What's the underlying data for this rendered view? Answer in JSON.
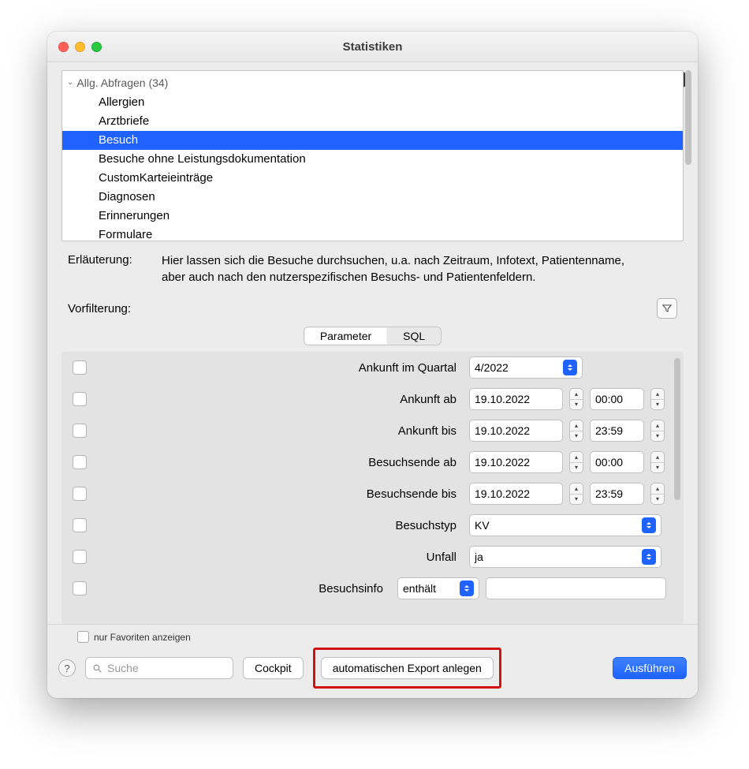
{
  "window": {
    "title": "Statistiken"
  },
  "tree": {
    "group_label": "Allg. Abfragen (34)",
    "items": [
      {
        "label": "Allergien",
        "selected": false
      },
      {
        "label": "Arztbriefe",
        "selected": false
      },
      {
        "label": "Besuch",
        "selected": true
      },
      {
        "label": "Besuche ohne Leistungsdokumentation",
        "selected": false
      },
      {
        "label": "CustomKarteieinträge",
        "selected": false
      },
      {
        "label": "Diagnosen",
        "selected": false
      },
      {
        "label": "Erinnerungen",
        "selected": false
      },
      {
        "label": "Formulare",
        "selected": false
      }
    ]
  },
  "explanation": {
    "label": "Erläuterung:",
    "text": "Hier lassen sich die Besuche durchsuchen, u.a. nach Zeitraum, Infotext, Patientenname,\naber auch nach den nutzerspezifischen Besuchs- und Patientenfeldern."
  },
  "prefilter": {
    "label": "Vorfilterung:"
  },
  "tabs": {
    "parameter": "Parameter",
    "sql": "SQL",
    "active": "parameter"
  },
  "params": {
    "rows": [
      {
        "id": "ankunft_quartal",
        "label": "Ankunft im Quartal",
        "type": "select_q",
        "value": "4/2022"
      },
      {
        "id": "ankunft_ab",
        "label": "Ankunft ab",
        "type": "datetime",
        "date": "19.10.2022",
        "time": "00:00"
      },
      {
        "id": "ankunft_bis",
        "label": "Ankunft bis",
        "type": "datetime",
        "date": "19.10.2022",
        "time": "23:59"
      },
      {
        "id": "besuchsende_ab",
        "label": "Besuchsende ab",
        "type": "datetime",
        "date": "19.10.2022",
        "time": "00:00"
      },
      {
        "id": "besuchsende_bis",
        "label": "Besuchsende bis",
        "type": "datetime",
        "date": "19.10.2022",
        "time": "23:59"
      },
      {
        "id": "besuchstyp",
        "label": "Besuchstyp",
        "type": "select_wide",
        "value": "KV"
      },
      {
        "id": "unfall",
        "label": "Unfall",
        "type": "select_wide",
        "value": "ja"
      },
      {
        "id": "besuchsinfo",
        "label": "Besuchsinfo",
        "type": "op_text",
        "op": "enthält",
        "text": ""
      }
    ]
  },
  "footer": {
    "favorites_label": "nur Favoriten anzeigen",
    "search_placeholder": "Suche",
    "cockpit": "Cockpit",
    "auto_export": "automatischen Export anlegen",
    "run": "Ausführen"
  }
}
